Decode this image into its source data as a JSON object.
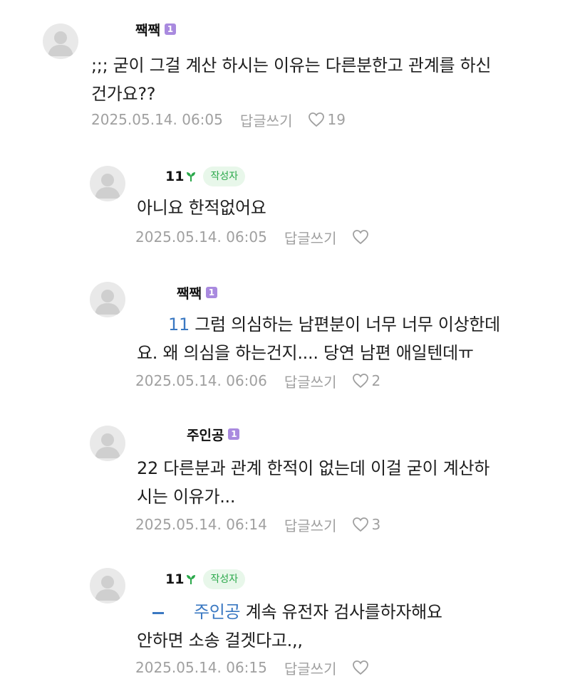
{
  "comments": [
    {
      "author": "짹짹",
      "level_badge": "1",
      "lines": [
        ";;; 굳이 그걸 계산 하시는 이유는 다른분한고 관계를 하신",
        "건가요??"
      ],
      "date": "2025.05.14. 06:05",
      "reply_label": "답글쓰기",
      "likes": "19"
    },
    {
      "author": "11",
      "writer_badge": "작성자",
      "lines": [
        "아니요 한적없어요"
      ],
      "date": "2025.05.14. 06:05",
      "reply_label": "답글쓰기",
      "likes": ""
    },
    {
      "author": "짹짹",
      "level_badge": "1",
      "mention": "11",
      "lines": [
        " 그럼 의심하는 남편분이 너무 너무 이상한데",
        "요. 왜 의심을 하는건지.... 당연 남편 애일텐데ㅠ"
      ],
      "date": "2025.05.14. 06:06",
      "reply_label": "답글쓰기",
      "likes": "2"
    },
    {
      "author": "주인공",
      "level_badge": "1",
      "lines": [
        "22 다른분과 관계 한적이 없는데 이걸 굳이 계산하",
        "시는 이유가..."
      ],
      "date": "2025.05.14. 06:14",
      "reply_label": "답글쓰기",
      "likes": "3"
    },
    {
      "author": "11",
      "writer_badge": "작성자",
      "mention": "주인공",
      "lines": [
        " 계속 유전자 검사를하자해요",
        "안하면 소송 걸겟다고.,,"
      ],
      "date": "2025.05.14. 06:15",
      "reply_label": "답글쓰기",
      "likes": ""
    }
  ],
  "colors": {
    "mention": "#3a78c2",
    "meta": "#a0a0a0",
    "level_badge": "#a98adf",
    "writer_badge_bg": "#e8f7ea",
    "writer_badge_text": "#2aa84a"
  },
  "icons": {
    "avatar": "default-profile-icon",
    "like": "heart-outline-icon",
    "sprout": "sprout-icon"
  }
}
